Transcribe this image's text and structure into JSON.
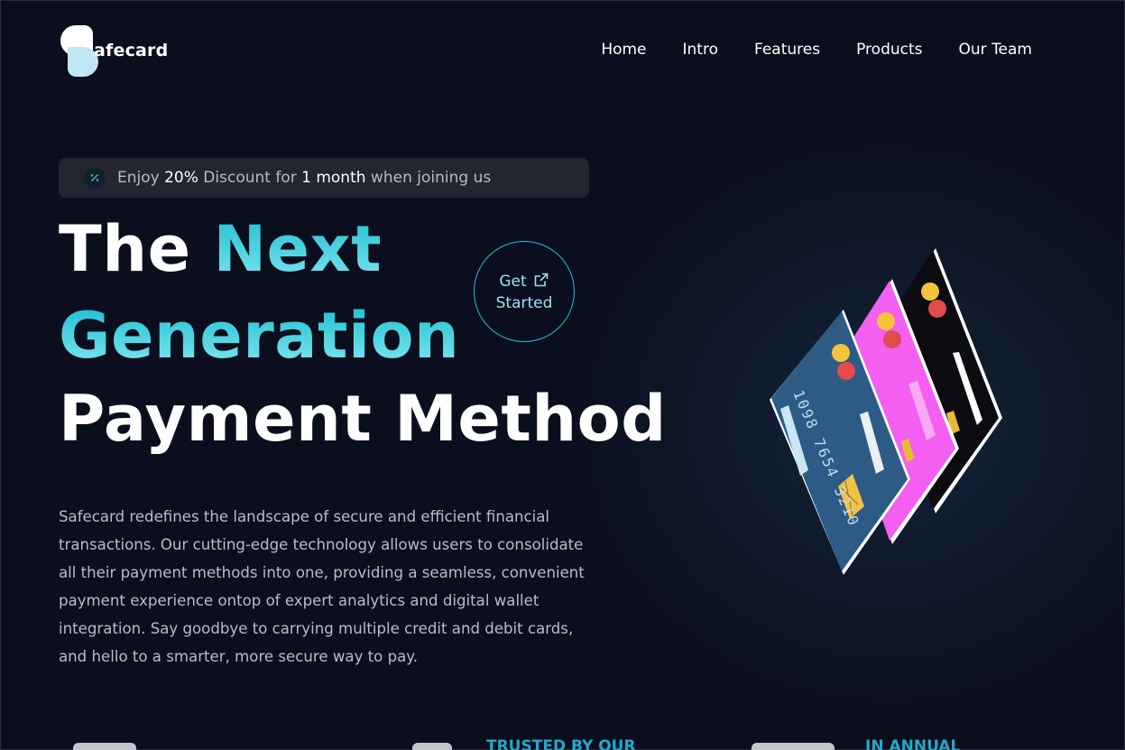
{
  "brand": {
    "name": "Safecard",
    "logo_text": "afecard"
  },
  "nav": {
    "items": [
      "Home",
      "Intro",
      "Features",
      "Products",
      "Our Team"
    ]
  },
  "promo": {
    "icon": "percent-icon",
    "part1": "Enjoy ",
    "discount": "20%",
    "part2": " Discount for ",
    "duration": "1 month",
    "part3": " when joining us"
  },
  "hero": {
    "line1_a": "The ",
    "line1_b": "Next",
    "line2": "Generation",
    "line3": "Payment Method",
    "cta_line1": "Get",
    "cta_line2": "Started",
    "description": "Safecard redefines the landscape of secure and efficient financial transactions. Our cutting-edge technology allows users to consolidate all their payment methods into one, providing a seamless, convenient payment experience ontop of expert analytics and digital wallet integration. Say goodbye to carrying multiple credit and debit cards, and hello to a smarter, more secure way to pay."
  },
  "cards_illustration": {
    "card_number": "1098 7654 3210",
    "colors": {
      "front": "#2d5b86",
      "middle": "#f35ff0",
      "back": "#0c0c10"
    }
  },
  "stats_partial": {
    "label1": "TRUSTED BY OUR",
    "label2": "IN ANNUAL"
  },
  "colors": {
    "accent": "#29b8d8",
    "background": "#0b0f1d",
    "promo_bg": "#23262f"
  }
}
